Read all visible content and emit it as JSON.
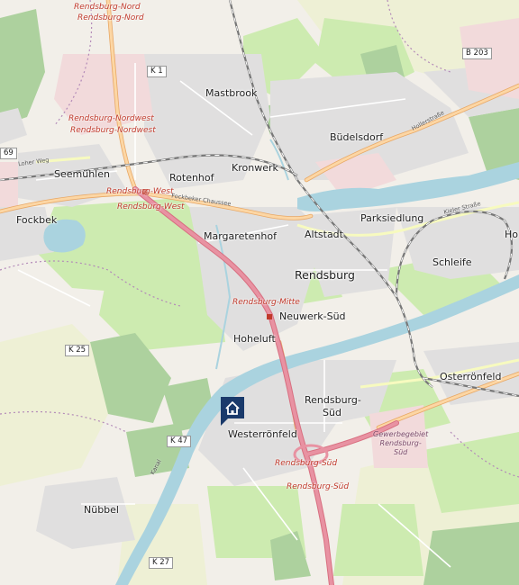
{
  "map": {
    "places": {
      "mastbrook": "Mastbrook",
      "budelsdorf": "Büdelsdorf",
      "kronwerk": "Kronwerk",
      "rotenhof": "Rotenhof",
      "seemuehlen": "Seemühlen",
      "fockbek": "Fockbek",
      "margaretenhof": "Margaretenhof",
      "altstadt": "Altstadt",
      "parksiedlung": "Parksiedlung",
      "ho": "Ho",
      "schleife": "Schleife",
      "rendsburg": "Rendsburg",
      "neuwerk_sued": "Neuwerk-Süd",
      "hoheluft": "Hoheluft",
      "osterroenfeld": "Osterrönfeld",
      "rendsburg_sued_1": "Rendsburg-",
      "rendsburg_sued_2": "Süd",
      "westerroenfeld": "Westerrönfeld",
      "nuebbel": "Nübbel"
    },
    "stations": {
      "nord_1": "Rendsburg-Nord",
      "nord_2": "Rendsburg-Nord",
      "nordwest_1": "Rendsburg-Nordwest",
      "nordwest_2": "Rendsburg-Nordwest",
      "west_1": "Rendsburg-West",
      "west_2": "Rendsburg-West",
      "mitte": "Rendsburg-Mitte",
      "sued_1": "Rendsburg-Süd",
      "sued_2": "Rendsburg-Süd"
    },
    "streets": {
      "hollerstrasse": "Hollerstraße",
      "loher_weg": "Loher Weg",
      "fockbeker_chaussee": "Fockbeker Chaussee",
      "kieler_strasse": "Kieler Straße",
      "kanal": "Kanal"
    },
    "industrial": {
      "line1": "Gewerbegebiet",
      "line2": "Rendsburg-",
      "line3": "Süd"
    },
    "road_shields": {
      "k1": "K 1",
      "b203": "B 203",
      "r69": "69",
      "k25": "K 25",
      "k47": "K 47",
      "k27": "K 27"
    },
    "marker_icon": "home-icon",
    "colors": {
      "water": "#aad3df",
      "forest": "#add19e",
      "grass": "#cdebb0",
      "residential": "#e0dfdf",
      "motorway": "#e892a2",
      "primary": "#fcd6a4",
      "railway": "#777777",
      "marker": "#1a3a6b"
    }
  }
}
